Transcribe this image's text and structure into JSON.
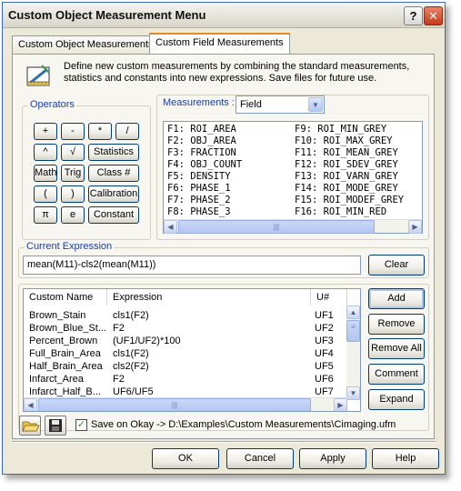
{
  "window": {
    "title": "Custom Object Measurement Menu",
    "help_button": "?",
    "close_button": "✕"
  },
  "tabs": [
    {
      "label": "Custom Object Measurements"
    },
    {
      "label": "Custom Field Measurements"
    }
  ],
  "description": "Define new custom measurements by combining the standard measurements, statistics and constants into new expressions. Save files for future use.",
  "operators": {
    "legend": "Operators",
    "buttons": [
      "+",
      "-",
      "*",
      "/",
      "^",
      "√",
      "Statistics",
      "Math",
      "Trig",
      "Class #",
      "(",
      ")",
      "Calibration",
      "π",
      "e",
      "Constant"
    ]
  },
  "measurements": {
    "label": "Measurements :",
    "type_selected": "Field",
    "items": [
      "F1: ROI_AREA",
      "F2: OBJ_AREA",
      "F3: FRACTION",
      "F4: OBJ_COUNT",
      "F5: DENSITY",
      "F6: PHASE_1",
      "F7: PHASE_2",
      "F8: PHASE_3",
      "F9: ROI_MIN_GREY",
      "F10: ROI_MAX_GREY",
      "F11: ROI_MEAN_GREY",
      "F12: ROI_SDEV_GREY",
      "F13: ROI_VARN_GREY",
      "F14: ROI_MODE_GREY",
      "F15: ROI_MODEF_GREY",
      "F16: ROI_MIN_RED"
    ]
  },
  "current_expression": {
    "legend": "Current Expression",
    "value": "mean(M11)-cls2(mean(M11))",
    "clear_label": "Clear"
  },
  "custom_list": {
    "headers": [
      "Custom Name",
      "Expression",
      "U#"
    ],
    "rows": [
      {
        "name": "Brown_Stain",
        "expr": "cls1(F2)",
        "id": "UF1"
      },
      {
        "name": "Brown_Blue_St...",
        "expr": "F2",
        "id": "UF2"
      },
      {
        "name": "Percent_Brown",
        "expr": "(UF1/UF2)*100",
        "id": "UF3"
      },
      {
        "name": "Full_Brain_Area",
        "expr": "cls1(F2)",
        "id": "UF4"
      },
      {
        "name": "Half_Brain_Area",
        "expr": "cls2(F2)",
        "id": "UF5"
      },
      {
        "name": "Infarct_Area",
        "expr": "F2",
        "id": "UF6"
      },
      {
        "name": "Infarct_Half_B...",
        "expr": "UF6/UF5",
        "id": "UF7"
      }
    ],
    "buttons": {
      "add": "Add",
      "remove": "Remove",
      "remove_all": "Remove All",
      "comment": "Comment",
      "expand": "Expand"
    }
  },
  "save": {
    "checkbox_checked": true,
    "label": "Save on Okay -> D:\\Examples\\Custom Measurements\\Cimaging.ufm"
  },
  "footer": {
    "ok": "OK",
    "cancel": "Cancel",
    "apply": "Apply",
    "help": "Help"
  }
}
